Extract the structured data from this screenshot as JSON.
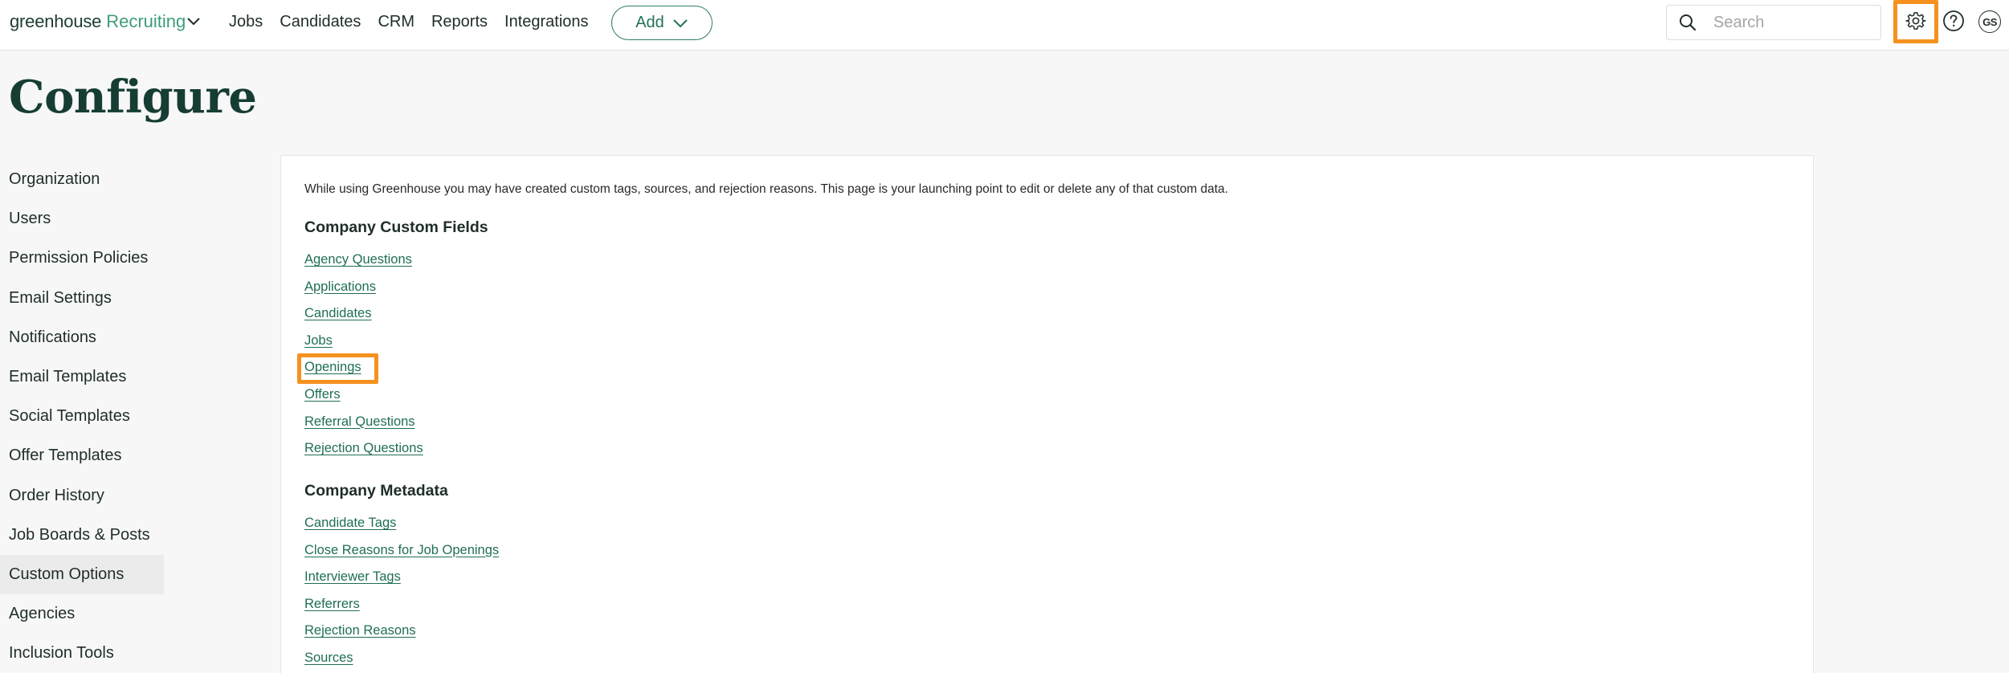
{
  "app": {
    "logo_main": "greenhouse",
    "logo_product": "Recruiting"
  },
  "nav": {
    "items": [
      "Jobs",
      "Candidates",
      "CRM",
      "Reports",
      "Integrations"
    ],
    "add_label": "Add"
  },
  "search": {
    "placeholder": "Search"
  },
  "user": {
    "initials": "GS"
  },
  "page": {
    "title": "Configure"
  },
  "sidebar": {
    "items": [
      "Organization",
      "Users",
      "Permission Policies",
      "Email Settings",
      "Notifications",
      "Email Templates",
      "Social Templates",
      "Offer Templates",
      "Order History",
      "Job Boards & Posts",
      "Custom Options",
      "Agencies",
      "Inclusion Tools"
    ],
    "active": "Custom Options"
  },
  "content": {
    "intro": "While using Greenhouse you may have created custom tags, sources, and rejection reasons. This page is your launching point to edit or delete any of that custom data.",
    "custom_fields": {
      "title": "Company Custom Fields",
      "links": [
        "Agency Questions",
        "Applications",
        "Candidates",
        "Jobs",
        "Openings",
        "Offers",
        "Referral Questions",
        "Rejection Questions"
      ]
    },
    "metadata": {
      "title": "Company Metadata",
      "links": [
        "Candidate Tags",
        "Close Reasons for Job Openings",
        "Interviewer Tags",
        "Referrers",
        "Rejection Reasons",
        "Sources"
      ]
    }
  },
  "colors": {
    "brand_green": "#3f9d78",
    "link_green": "#1f6e56",
    "highlight": "#f5921f"
  }
}
